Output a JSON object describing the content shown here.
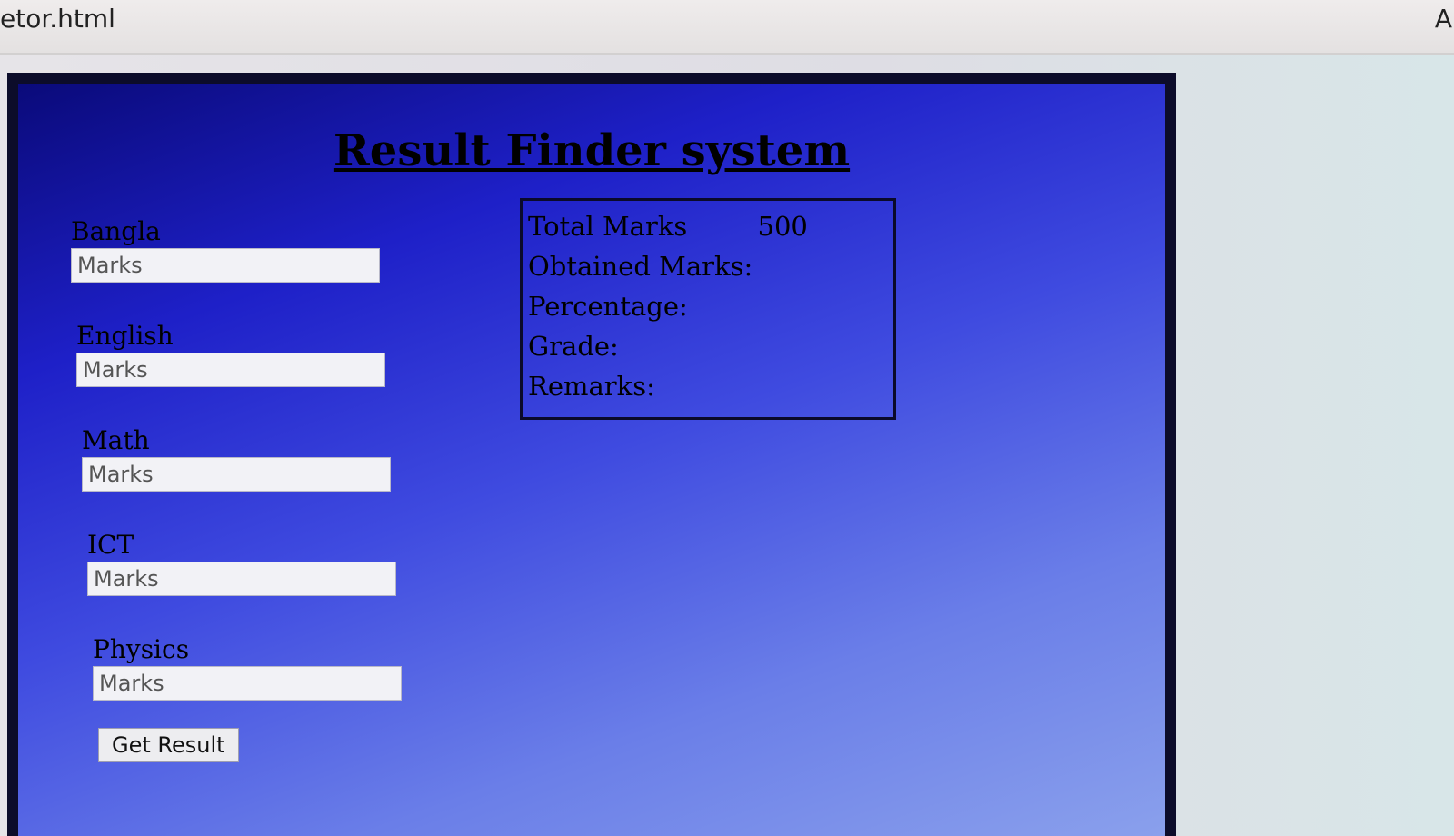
{
  "browser": {
    "tab_title": "etor.html",
    "right_glyph": "A"
  },
  "page": {
    "title": "Result Finder system"
  },
  "form": {
    "fields": [
      {
        "label": "Bangla",
        "placeholder": "Marks"
      },
      {
        "label": "English",
        "placeholder": "Marks"
      },
      {
        "label": "Math",
        "placeholder": "Marks"
      },
      {
        "label": "ICT",
        "placeholder": "Marks"
      },
      {
        "label": "Physics",
        "placeholder": "Marks"
      }
    ],
    "submit_label": "Get Result"
  },
  "result": {
    "total_label": "Total Marks",
    "total_value": "500",
    "obtained_label": "Obtained Marks:",
    "percentage_label": "Percentage:",
    "grade_label": "Grade:",
    "remarks_label": "Remarks:"
  }
}
